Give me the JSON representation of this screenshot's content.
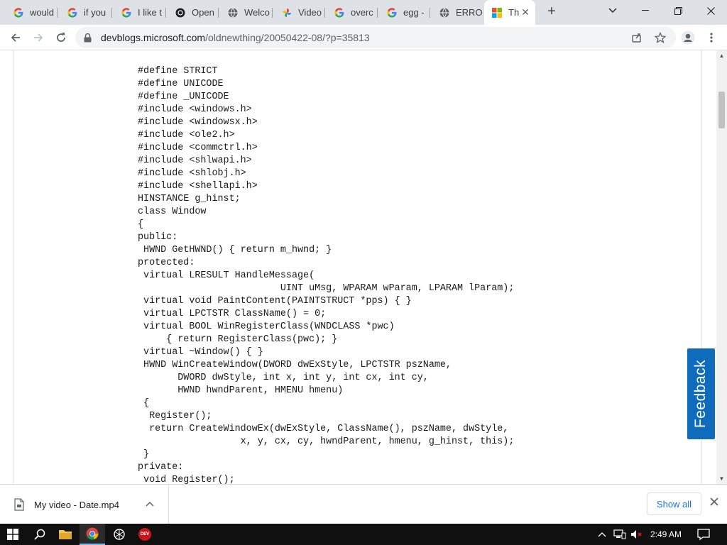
{
  "browser": {
    "tabs": [
      {
        "title": "would",
        "favicon": "google-icon"
      },
      {
        "title": "if you",
        "favicon": "google-icon"
      },
      {
        "title": "I like t",
        "favicon": "google-icon"
      },
      {
        "title": "Open",
        "favicon": "openai-icon"
      },
      {
        "title": "Welco",
        "favicon": "globe-icon"
      },
      {
        "title": "Video",
        "favicon": "photos-icon"
      },
      {
        "title": "overc",
        "favicon": "google-icon"
      },
      {
        "title": "egg -",
        "favicon": "google-icon"
      },
      {
        "title": "ERROR",
        "favicon": "globe-icon"
      },
      {
        "title": "Th",
        "favicon": "microsoft-icon",
        "active": true
      }
    ],
    "new_tab_label": "+",
    "url_host": "devblogs.microsoft.com",
    "url_path": "/oldnewthing/20050422-08/?p=35813"
  },
  "code_lines": [
    "#define STRICT",
    "#define UNICODE",
    "#define _UNICODE",
    "#include <windows.h>",
    "#include <windowsx.h>",
    "#include <ole2.h>",
    "#include <commctrl.h>",
    "#include <shlwapi.h>",
    "#include <shlobj.h>",
    "#include <shellapi.h>",
    "HINSTANCE g_hinst;",
    "class Window",
    "{",
    "public:",
    " HWND GetHWND() { return m_hwnd; }",
    "protected:",
    " virtual LRESULT HandleMessage(",
    "                         UINT uMsg, WPARAM wParam, LPARAM lParam);",
    " virtual void PaintContent(PAINTSTRUCT *pps) { }",
    " virtual LPCTSTR ClassName() = 0;",
    " virtual BOOL WinRegisterClass(WNDCLASS *pwc)",
    "     { return RegisterClass(pwc); }",
    " virtual ~Window() { }",
    " HWND WinCreateWindow(DWORD dwExStyle, LPCTSTR pszName,",
    "       DWORD dwStyle, int x, int y, int cx, int cy,",
    "       HWND hwndParent, HMENU hmenu)",
    " {",
    "  Register();",
    "  return CreateWindowEx(dwExStyle, ClassName(), pszName, dwStyle,",
    "                  x, y, cx, cy, hwndParent, hmenu, g_hinst, this);",
    " }",
    "private:",
    " void Register();"
  ],
  "feedback_label": "Feedback",
  "downloads": {
    "file_name": "My video - Date.mp4",
    "show_all_label": "Show all"
  },
  "taskbar": {
    "time": "2:49 AM",
    "dev_badge": "DEV"
  },
  "colors": {
    "feedback_bg": "#0f6cbd",
    "link_blue": "#1a73e8",
    "taskbar_bg": "#101010"
  }
}
